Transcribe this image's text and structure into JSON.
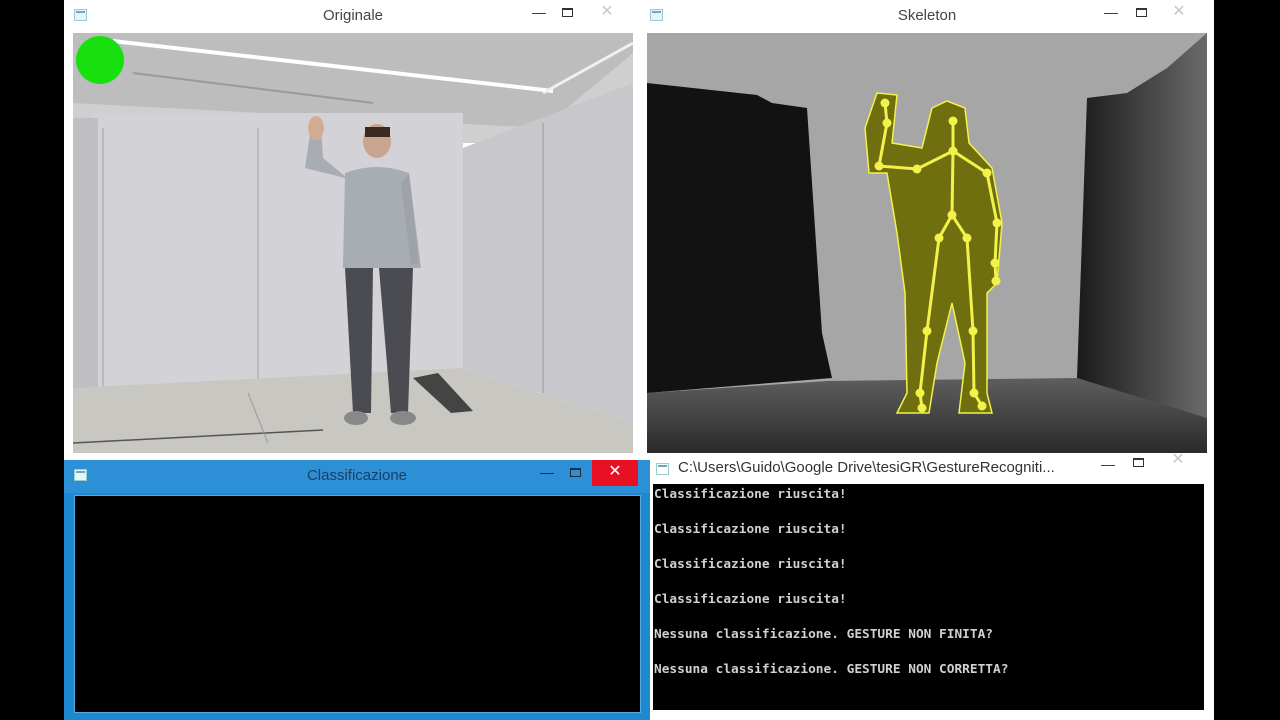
{
  "windows": {
    "originale": {
      "title": "Originale",
      "status_indicator_color": "#18e00f"
    },
    "skeleton": {
      "title": "Skeleton",
      "skeleton_color": "#f2f24a",
      "silhouette_color": "#6f6f10"
    },
    "classificazione": {
      "title": "Classificazione",
      "close_symbol": "✕"
    },
    "console": {
      "title": "C:\\Users\\Guido\\Google Drive\\tesiGR\\GestureRecogniti...",
      "lines": [
        "Classificazione riuscita!",
        "Classificazione riuscita!",
        "Classificazione riuscita!",
        "Classificazione riuscita!",
        "Nessuna classificazione. GESTURE NON FINITA?",
        "Nessuna classificazione. GESTURE NON CORRETTA?"
      ]
    }
  },
  "controls": {
    "minimize": "—",
    "close": "✕"
  }
}
